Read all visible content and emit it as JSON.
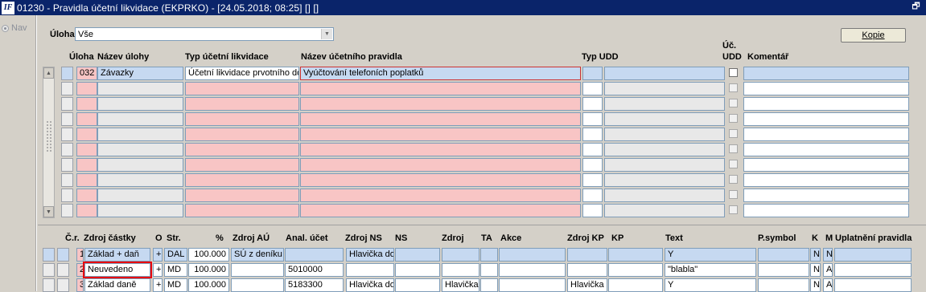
{
  "window": {
    "title": "01230 - Pravidla účetní likvidace (EKPRKO) - [24.05.2018; 08:25]  []  []",
    "app_icon_text": "IF"
  },
  "nav": {
    "label": "Nav"
  },
  "filter": {
    "label": "Úloha",
    "value": "Vše"
  },
  "kopie_button": "Kopie",
  "top_table": {
    "headers": {
      "uloha": "Úloha",
      "nazev_ulohy": "Název úlohy",
      "typ_likvidace": "Typ účetní likvidace",
      "nazev_pravidla": "Název účetního pravidla",
      "typ_udd": "Typ UDD",
      "uc_udd_1": "Úč.",
      "uc_udd_2": "UDD",
      "komentar": "Komentář"
    },
    "rows": [
      {
        "uloha": "032",
        "nazev_ulohy": "Závazky",
        "typ_likvidace": "Účetní likvidace prvotního do",
        "nazev_pravidla": "Vyúčtování telefoních poplatků",
        "typ_udd": "",
        "udd": "",
        "komentar": ""
      }
    ],
    "empty_rows": 9
  },
  "bottom_table": {
    "headers": {
      "cr": "Č.r.",
      "zdroj_castky": "Zdroj částky",
      "o": "O",
      "str": "Str.",
      "pct": "%",
      "zdroj_au": "Zdroj AÚ",
      "anal_ucet": "Anal. účet",
      "zdroj_ns": "Zdroj NS",
      "ns": "NS",
      "zdroj": "Zdroj",
      "ta": "TA",
      "akce": "Akce",
      "zdroj_kp": "Zdroj KP",
      "kp": "KP",
      "text": "Text",
      "psymbol": "P.symbol",
      "k": "K",
      "m": "M",
      "uplatneni": "Uplatnění pravidla"
    },
    "rows": [
      {
        "cr": "1",
        "zdroj_castky": "Základ + daň",
        "o": "+",
        "str": "DAL",
        "pct": "100.000",
        "zdroj_au": "SÚ z deníku",
        "anal_ucet": "",
        "zdroj_ns": "Hlavička do",
        "ns": "",
        "zdroj": "",
        "ta": "",
        "akce": "",
        "zdroj_kp": "",
        "kp": "",
        "text": "Y",
        "psymbol": "",
        "k": "N",
        "m": "N",
        "uplatneni": ""
      },
      {
        "cr": "2",
        "zdroj_castky": "Neuvedeno",
        "o": "+",
        "str": "MD",
        "pct": "100.000",
        "zdroj_au": "",
        "anal_ucet": "5010000",
        "zdroj_ns": "",
        "ns": "",
        "zdroj": "",
        "ta": "",
        "akce": "",
        "zdroj_kp": "",
        "kp": "",
        "text": "\"blabla\"",
        "psymbol": "",
        "k": "N",
        "m": "A",
        "uplatneni": ""
      },
      {
        "cr": "3",
        "zdroj_castky": "Základ daně",
        "o": "+",
        "str": "MD",
        "pct": "100.000",
        "zdroj_au": "",
        "anal_ucet": "5183300",
        "zdroj_ns": "Hlavička do",
        "ns": "",
        "zdroj": "Hlavička",
        "ta": "",
        "akce": "",
        "zdroj_kp": "Hlavička",
        "kp": "",
        "text": "Y",
        "psymbol": "",
        "k": "N",
        "m": "A",
        "uplatneni": ""
      }
    ]
  }
}
